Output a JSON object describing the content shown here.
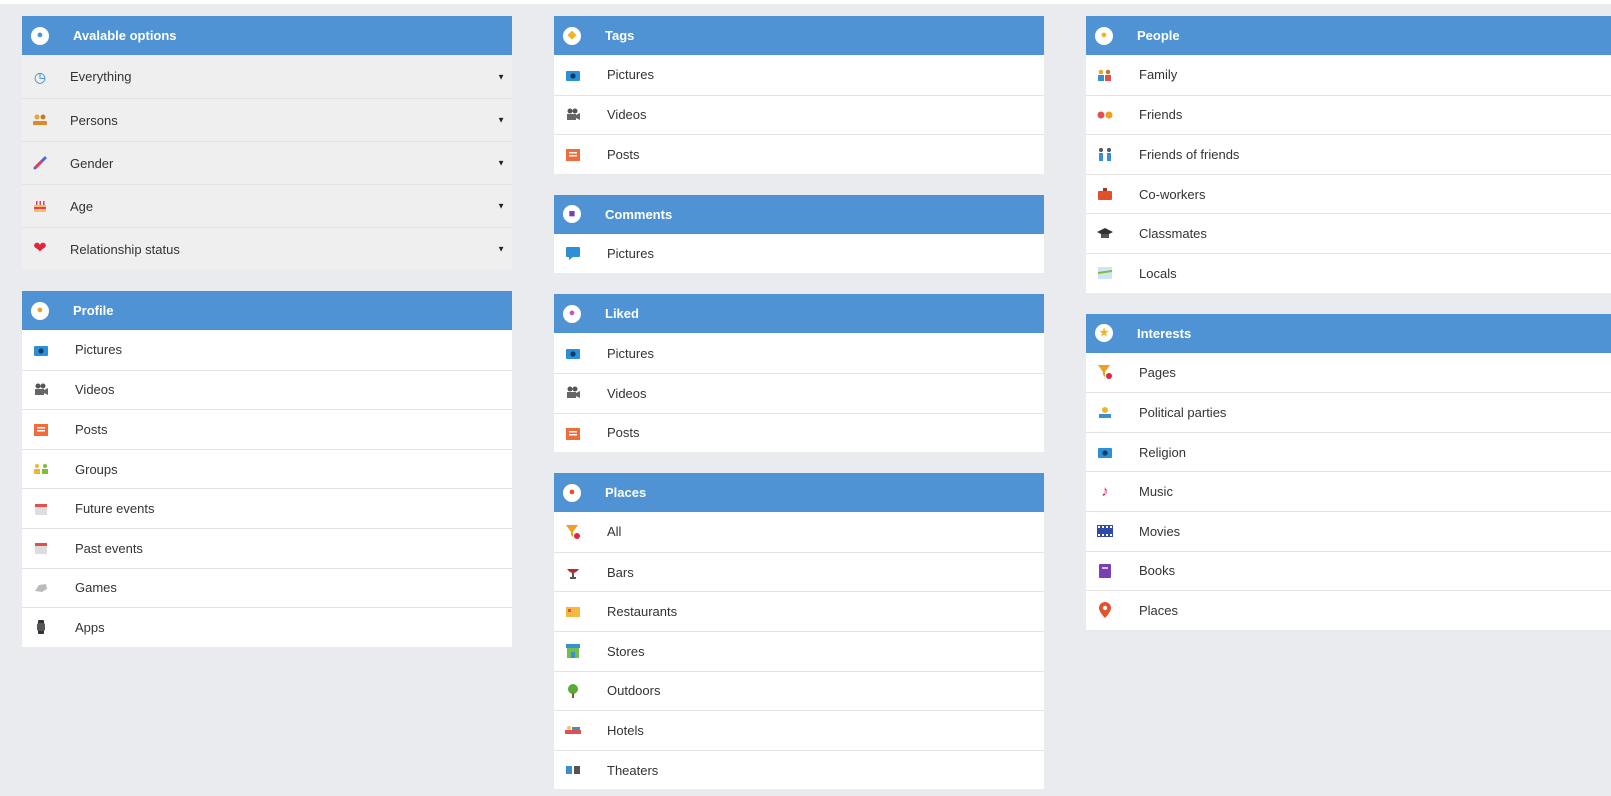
{
  "colors": {
    "header": "#4f93d4",
    "background": "#e9ebee",
    "rowOptions": "#efefef"
  },
  "available_options": {
    "title": "Avalable options",
    "icon": "info-icon",
    "items": [
      {
        "label": "Everything",
        "icon": "clock-icon"
      },
      {
        "label": "Persons",
        "icon": "persons-icon"
      },
      {
        "label": "Gender",
        "icon": "gender-icon"
      },
      {
        "label": "Age",
        "icon": "cake-icon"
      },
      {
        "label": "Relationship status",
        "icon": "heart-icon"
      }
    ]
  },
  "profile": {
    "title": "Profile",
    "icon": "user-icon",
    "items": [
      {
        "label": "Pictures",
        "icon": "camera-icon"
      },
      {
        "label": "Videos",
        "icon": "video-camera-icon"
      },
      {
        "label": "Posts",
        "icon": "posts-icon"
      },
      {
        "label": "Groups",
        "icon": "groups-icon"
      },
      {
        "label": "Future events",
        "icon": "calendar-icon"
      },
      {
        "label": "Past events",
        "icon": "calendar-icon"
      },
      {
        "label": "Games",
        "icon": "gamepad-icon"
      },
      {
        "label": "Apps",
        "icon": "watch-icon"
      }
    ]
  },
  "tags": {
    "title": "Tags",
    "icon": "tag-icon",
    "items": [
      {
        "label": "Pictures",
        "icon": "camera-icon"
      },
      {
        "label": "Videos",
        "icon": "video-camera-icon"
      },
      {
        "label": "Posts",
        "icon": "posts-icon"
      }
    ]
  },
  "comments": {
    "title": "Comments",
    "icon": "comment-icon",
    "items": [
      {
        "label": "Pictures",
        "icon": "speech-bubble-icon"
      }
    ]
  },
  "liked": {
    "title": "Liked",
    "icon": "like-icon",
    "items": [
      {
        "label": "Pictures",
        "icon": "camera-icon"
      },
      {
        "label": "Videos",
        "icon": "video-camera-icon"
      },
      {
        "label": "Posts",
        "icon": "posts-icon"
      }
    ]
  },
  "places": {
    "title": "Places",
    "icon": "location-icon",
    "items": [
      {
        "label": "All",
        "icon": "filter-icon"
      },
      {
        "label": "Bars",
        "icon": "glass-icon"
      },
      {
        "label": "Restaurants",
        "icon": "restaurant-icon"
      },
      {
        "label": "Stores",
        "icon": "store-icon"
      },
      {
        "label": "Outdoors",
        "icon": "tree-icon"
      },
      {
        "label": "Hotels",
        "icon": "bed-icon"
      },
      {
        "label": "Theaters",
        "icon": "theater-icon"
      }
    ]
  },
  "people": {
    "title": "People",
    "icon": "globe-icon",
    "items": [
      {
        "label": "Family",
        "icon": "family-icon"
      },
      {
        "label": "Friends",
        "icon": "friends-icon"
      },
      {
        "label": "Friends of friends",
        "icon": "friends-of-friends-icon"
      },
      {
        "label": "Co-workers",
        "icon": "briefcase-icon"
      },
      {
        "label": "Classmates",
        "icon": "graduation-cap-icon"
      },
      {
        "label": "Locals",
        "icon": "map-icon"
      }
    ]
  },
  "interests": {
    "title": "Interests",
    "icon": "star-icon",
    "items": [
      {
        "label": "Pages",
        "icon": "filter-icon"
      },
      {
        "label": "Political parties",
        "icon": "political-icon"
      },
      {
        "label": "Religion",
        "icon": "camera-icon"
      },
      {
        "label": "Music",
        "icon": "music-note-icon"
      },
      {
        "label": "Movies",
        "icon": "film-icon"
      },
      {
        "label": "Books",
        "icon": "book-icon"
      },
      {
        "label": "Places",
        "icon": "location-icon"
      }
    ]
  }
}
